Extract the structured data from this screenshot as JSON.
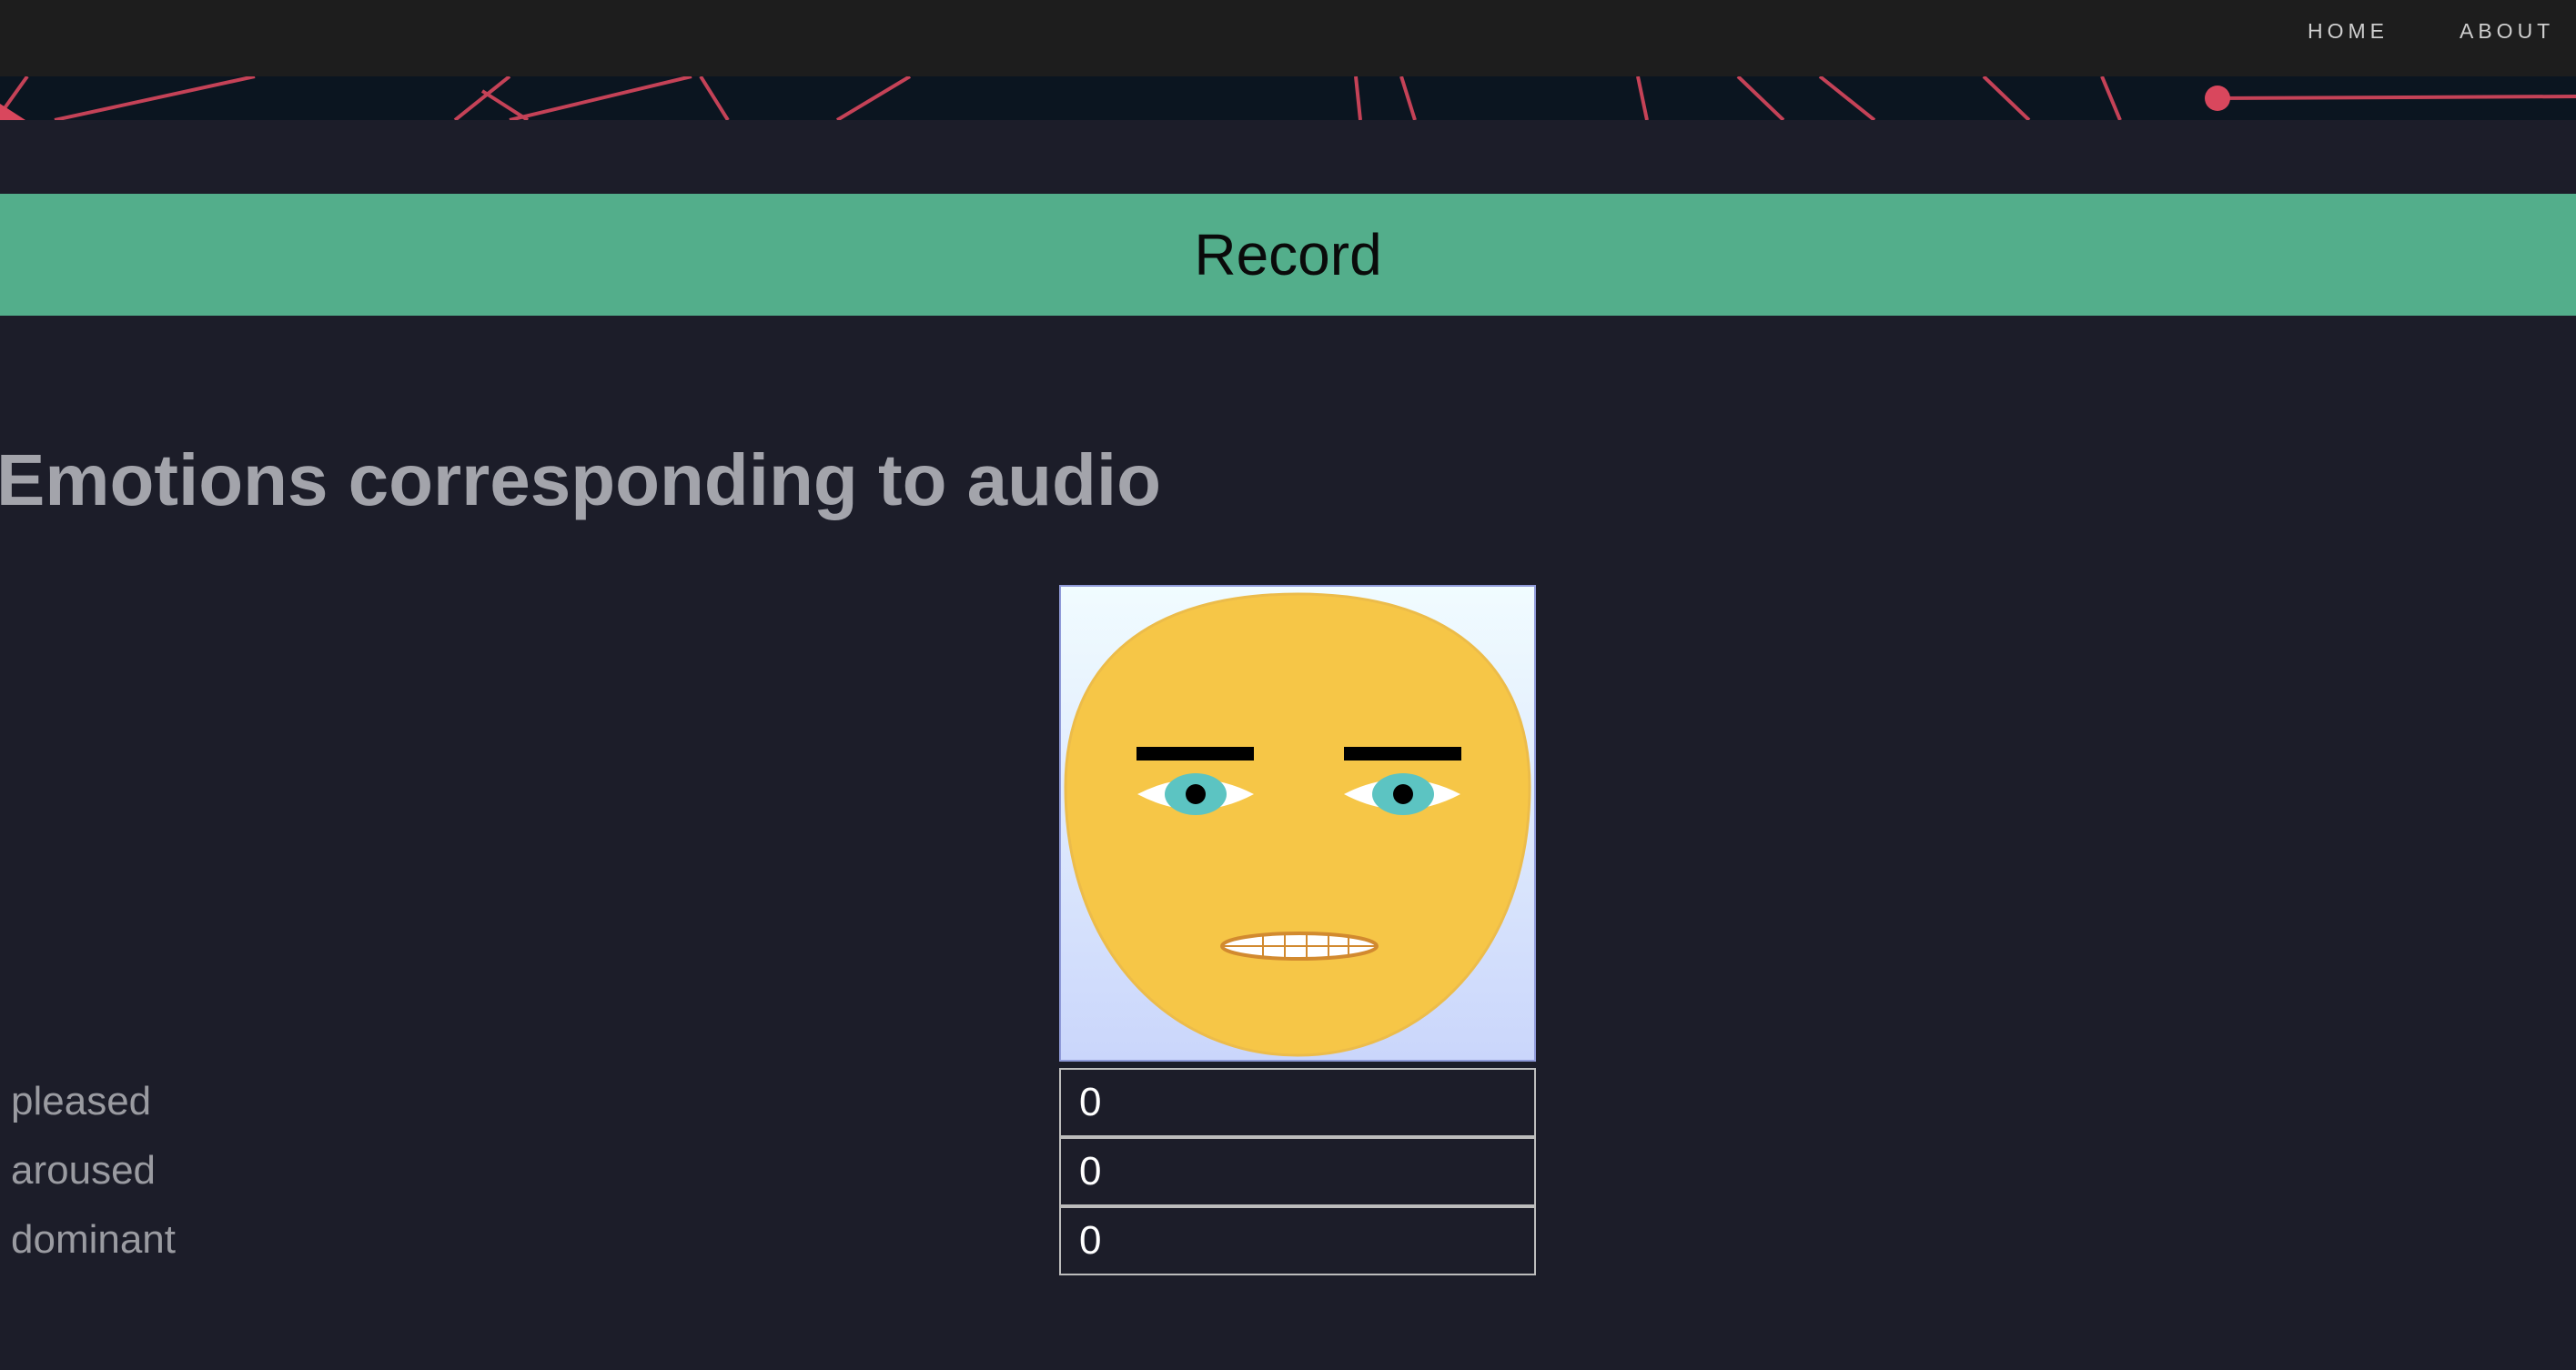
{
  "nav": {
    "home_label": "HOME",
    "about_label": "ABOUT"
  },
  "record": {
    "label": "Record"
  },
  "emotions": {
    "title": "Emotions corresponding to audio",
    "metrics": [
      {
        "label": "pleased",
        "value": "0"
      },
      {
        "label": "aroused",
        "value": "0"
      },
      {
        "label": "dominant",
        "value": "0"
      }
    ]
  },
  "colors": {
    "record_bar": "#53ae8b",
    "page_background": "#1c1d29",
    "nav_background": "#1d1d1d",
    "banner_line": "#d9475d",
    "face": "#f6c647"
  },
  "icons": {
    "face": "emotion-face-neutral"
  }
}
